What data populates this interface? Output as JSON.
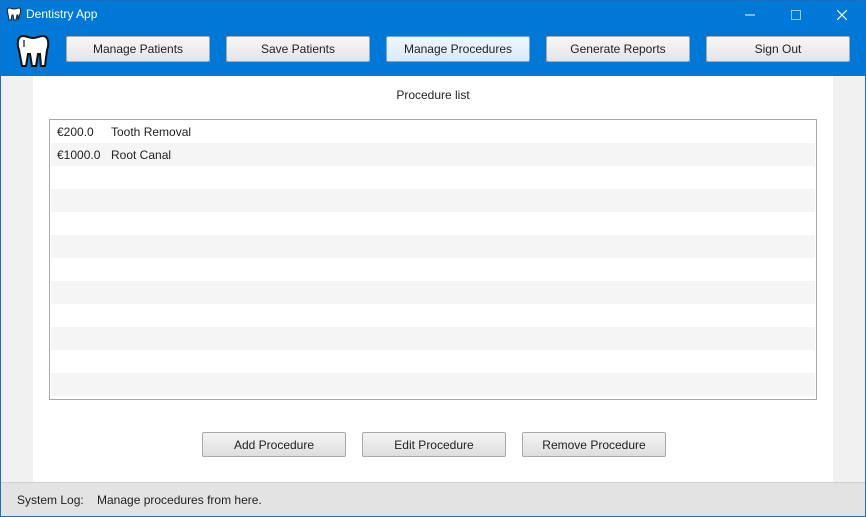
{
  "window": {
    "title": "Dentistry App",
    "minimize_glyph": "—",
    "maximize_glyph": "☐",
    "close_glyph": "✕"
  },
  "toolbar": {
    "buttons": [
      {
        "label": "Manage Patients"
      },
      {
        "label": "Save Patients"
      },
      {
        "label": "Manage Procedures",
        "active": true
      },
      {
        "label": "Generate Reports"
      },
      {
        "label": "Sign Out"
      }
    ]
  },
  "main": {
    "list_title": "Procedure list",
    "procedures": [
      {
        "price": "€200.0",
        "name": "Tooth Removal"
      },
      {
        "price": "€1000.0",
        "name": "Root Canal"
      }
    ],
    "actions": {
      "add_label": "Add Procedure",
      "edit_label": "Edit Procedure",
      "remove_label": "Remove Procedure"
    }
  },
  "status": {
    "label": "System Log:",
    "message": "Manage procedures from here."
  },
  "colors": {
    "accent": "#0078d7",
    "alt_row": "#f5f5f5"
  },
  "icons": {
    "app": "tooth-icon",
    "logo": "tooth-logo-icon"
  }
}
